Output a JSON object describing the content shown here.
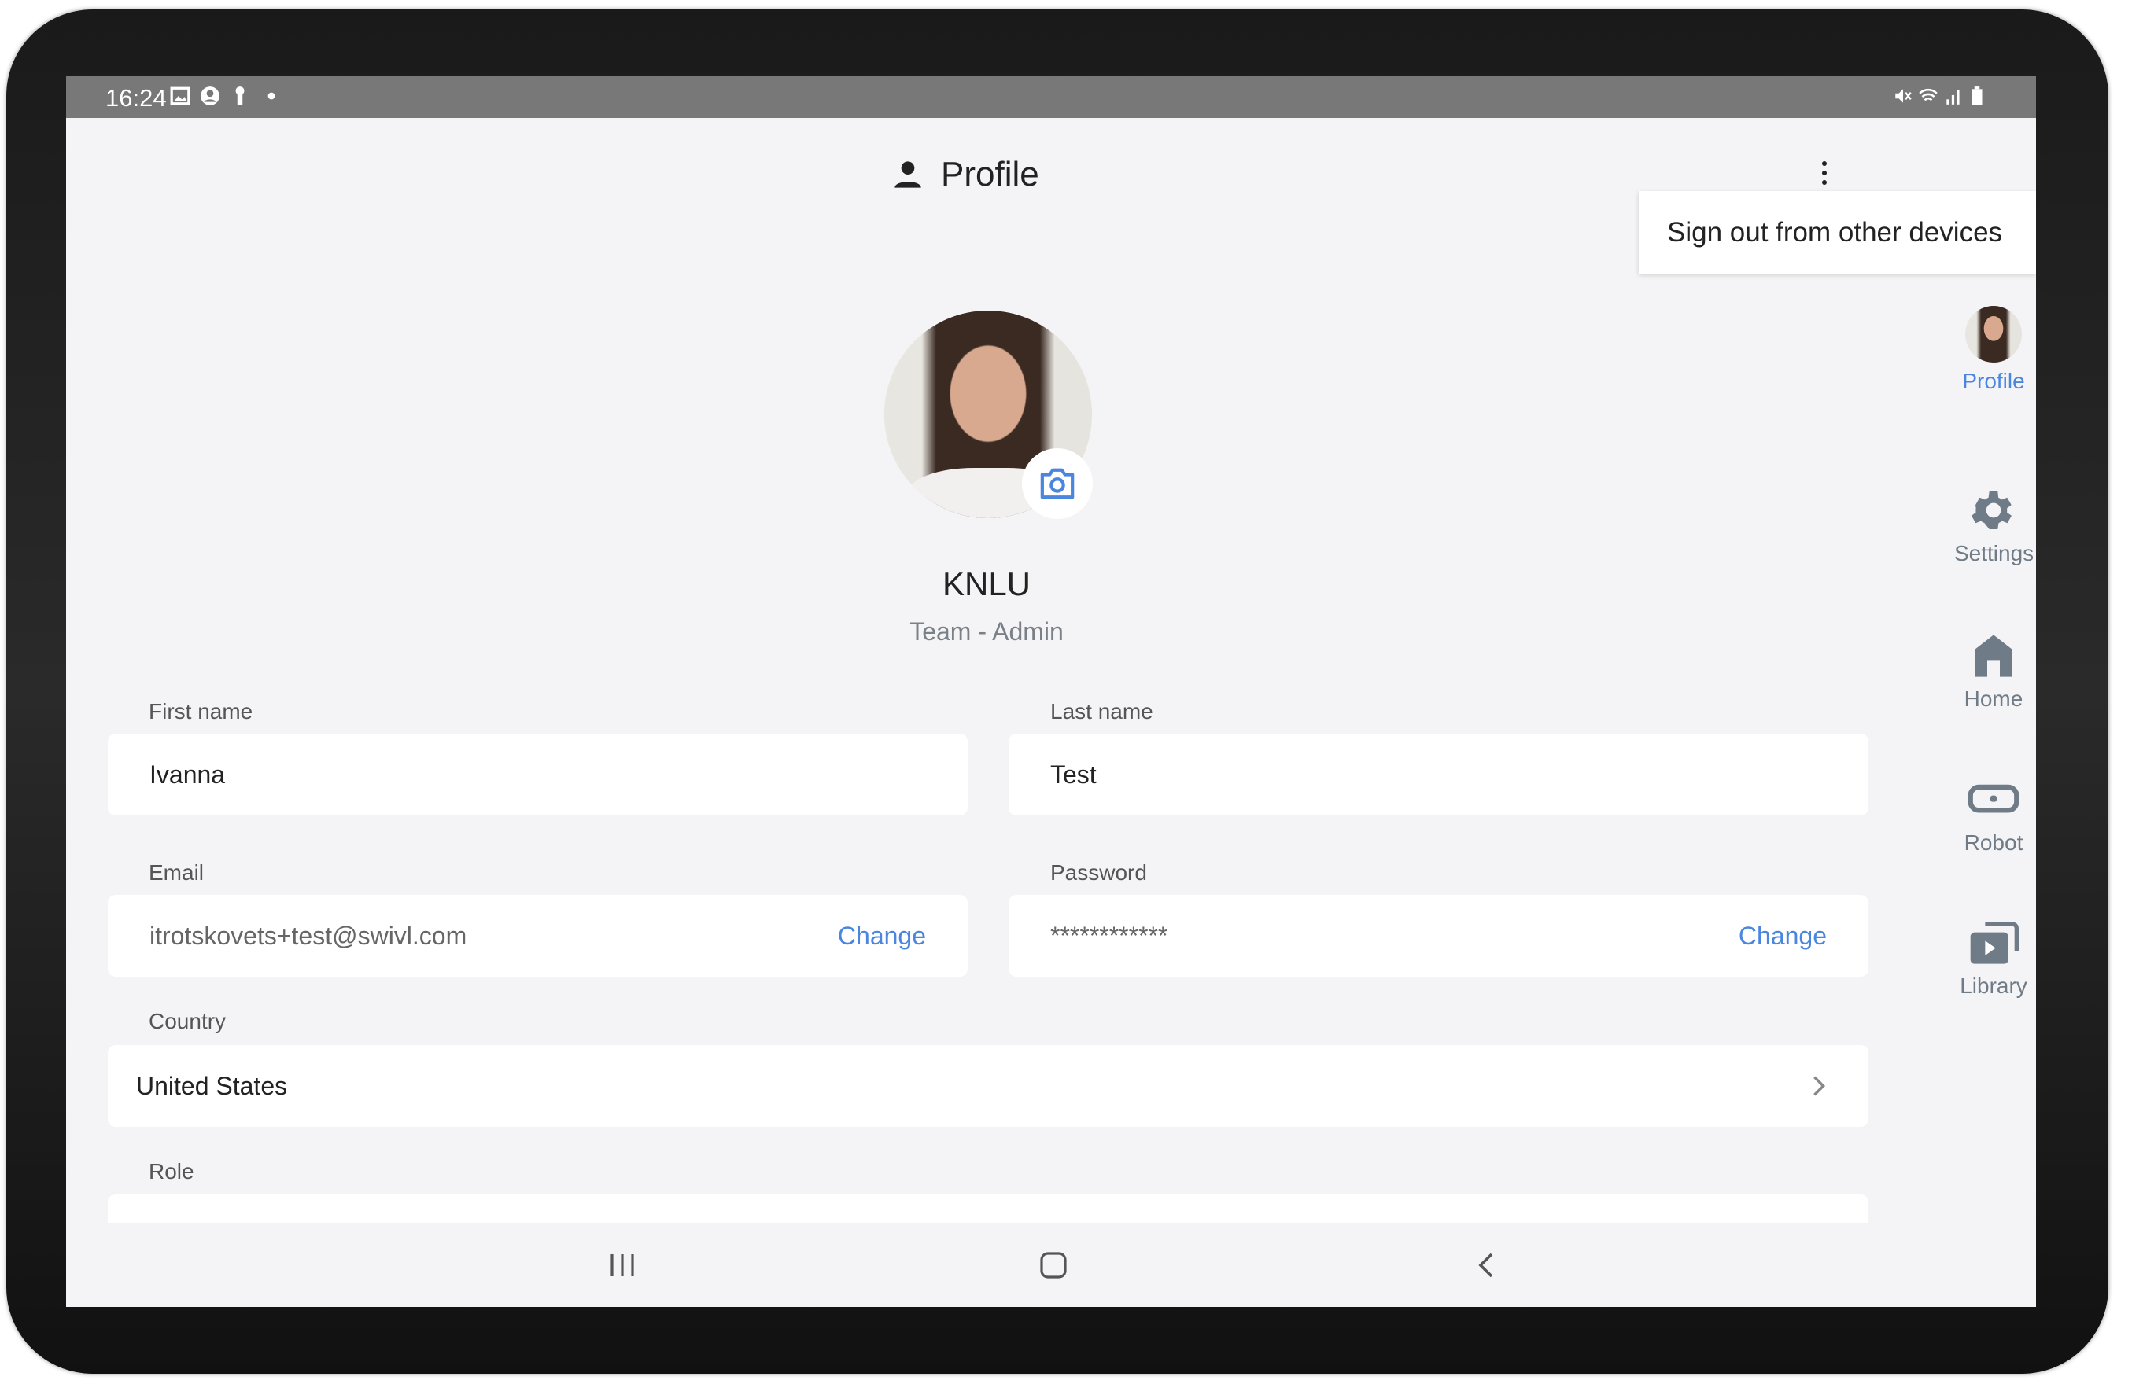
{
  "status_bar": {
    "time": "16:24",
    "left_icons": [
      "image-icon",
      "account-circle-icon",
      "key-icon",
      "dot-icon"
    ],
    "right_icons": [
      "mute-icon",
      "wifi-icon",
      "signal-icon",
      "battery-icon"
    ]
  },
  "header": {
    "title": "Profile",
    "icon": "person-icon"
  },
  "menu": {
    "items": [
      "Sign out from other devices"
    ]
  },
  "profile": {
    "name": "KNLU",
    "subtitle": "Team - Admin"
  },
  "form": {
    "first_name": {
      "label": "First name",
      "value": "Ivanna"
    },
    "last_name": {
      "label": "Last name",
      "value": "Test"
    },
    "email": {
      "label": "Email",
      "value": "itrotskovets+test@swivl.com",
      "action": "Change"
    },
    "password": {
      "label": "Password",
      "value": "************",
      "action": "Change"
    },
    "country": {
      "label": "Country",
      "value": "United States"
    },
    "role": {
      "label": "Role"
    }
  },
  "rail": {
    "items": [
      {
        "label": "Profile",
        "active": true
      },
      {
        "label": "Settings"
      },
      {
        "label": "Home"
      },
      {
        "label": "Robot"
      },
      {
        "label": "Library"
      }
    ]
  },
  "colors": {
    "accent": "#4a86e0",
    "rail_icon": "#6f7b87",
    "background": "#f4f4f6",
    "status_bar": "#787878"
  }
}
